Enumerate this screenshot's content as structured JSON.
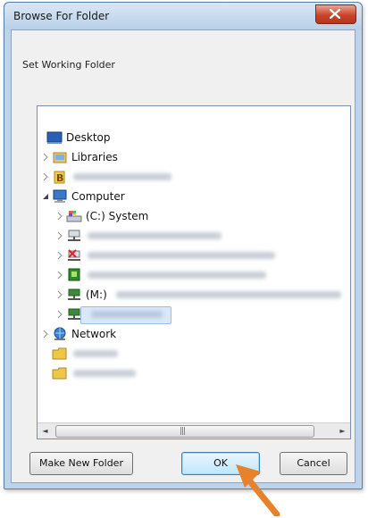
{
  "window": {
    "title": "Browse For Folder"
  },
  "dialog": {
    "description": "Set Working Folder"
  },
  "tree": {
    "items": [
      {
        "label": "Desktop",
        "icon": "desktop-icon"
      },
      {
        "label": "Libraries",
        "icon": "libraries-icon"
      },
      {
        "label": "",
        "icon": "user-folder-icon"
      },
      {
        "label": "Computer",
        "icon": "computer-icon"
      },
      {
        "label": "(C:) System",
        "icon": "drive-icon"
      },
      {
        "label": "",
        "icon": "network-drive-icon"
      },
      {
        "label": "",
        "icon": "disconnected-drive-icon"
      },
      {
        "label": "",
        "icon": "network-drive-icon"
      },
      {
        "label": "(M:)",
        "icon": "network-drive-icon"
      },
      {
        "label": "",
        "icon": "network-drive-icon"
      },
      {
        "label": "Network",
        "icon": "network-icon"
      },
      {
        "label": "",
        "icon": "folder-icon"
      },
      {
        "label": "",
        "icon": "folder-icon"
      }
    ]
  },
  "scrollbar": {
    "left": "◄",
    "right": "►",
    "grip": "|||"
  },
  "buttons": {
    "new_folder": "Make New Folder",
    "ok": "OK",
    "cancel": "Cancel"
  },
  "colors": {
    "selection": "#dbe8f8",
    "arrow": "#e8822a",
    "close": "#c9452a"
  }
}
